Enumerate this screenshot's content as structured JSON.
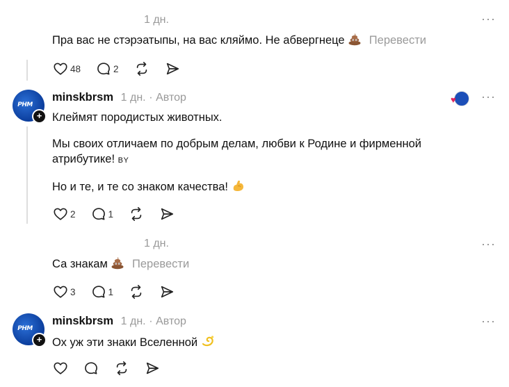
{
  "comments": [
    {
      "time": "1 дн.",
      "lines": [
        "Пра вас не стэрэатыпы, на вас кляймо. Не абвергнеце"
      ],
      "translate": "Перевести",
      "likes": "48",
      "replies": "2",
      "more": "···"
    },
    {
      "user": "minskbrsm",
      "time": "1 дн.",
      "author": "Автор",
      "line1": "Клеймят породистых животных.",
      "line2": "Мы своих отличаем по добрым делам, любви к Родине и фирменной атрибутике!",
      "line2_flag": "BY",
      "line3": "Но и те, и те со знаком качества!",
      "likes": "2",
      "replies": "1",
      "more": "···",
      "avatar_text": "РНМ"
    },
    {
      "time": "1 дн.",
      "line1": "Са знакам",
      "translate": "Перевести",
      "likes": "3",
      "replies": "1",
      "more": "···"
    },
    {
      "user": "minskbrsm",
      "time": "1 дн.",
      "author": "Автор",
      "line1": "Ох уж эти знаки Вселенной",
      "more": "···",
      "avatar_text": "РНМ"
    }
  ],
  "colors": {
    "avatar": "#0b3d9c",
    "muted": "#999999",
    "text": "#111111"
  }
}
